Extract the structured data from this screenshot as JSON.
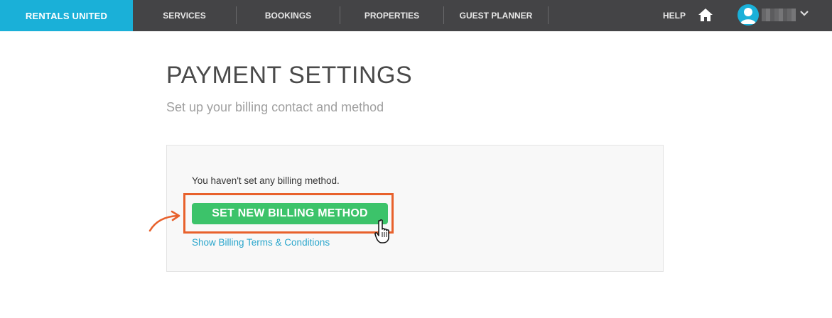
{
  "brand": {
    "name": "RENTALS UNITED",
    "color": "#1ab0d8"
  },
  "nav": {
    "items": [
      {
        "label": "SERVICES"
      },
      {
        "label": "BOOKINGS"
      },
      {
        "label": "PROPERTIES"
      },
      {
        "label": "GUEST PLANNER"
      }
    ],
    "help_label": "HELP",
    "icons": [
      "home-icon",
      "user-avatar-icon",
      "chevron-down-icon"
    ]
  },
  "main": {
    "title": "PAYMENT SETTINGS",
    "subtitle": "Set up your billing contact and method",
    "panel": {
      "message": "You haven't set any billing method.",
      "button_label": "SET NEW BILLING METHOD",
      "terms_link": "Show Billing Terms & Conditions"
    }
  },
  "colors": {
    "topbar": "#444446",
    "button": "#3cc36a",
    "highlight": "#e8612c",
    "link": "#2aa6cc"
  }
}
